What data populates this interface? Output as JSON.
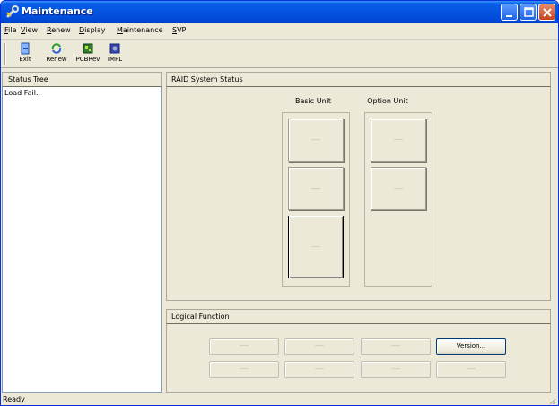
{
  "window": {
    "title": "Maintenance"
  },
  "menu": [
    {
      "label": "File",
      "hotkey": "F",
      "rest": "ile"
    },
    {
      "label": "View",
      "hotkey": "V",
      "rest": "iew"
    },
    {
      "label": "Renew",
      "hotkey": "R",
      "rest": "enew"
    },
    {
      "label": "Display",
      "hotkey": "D",
      "rest": "isplay"
    },
    {
      "label": "Maintenance",
      "hotkey": "M",
      "rest": "aintenance"
    },
    {
      "label": "SVP",
      "hotkey": "S",
      "rest": "VP"
    }
  ],
  "toolbar": {
    "exit": "Exit",
    "renew": "Renew",
    "pcbrev": "PCBRev",
    "impl": "IMPL"
  },
  "status_tree": {
    "header": "Status Tree",
    "message": "Load Fail.."
  },
  "raid": {
    "header": "RAID System Status",
    "basic_unit_label": "Basic Unit",
    "option_unit_label": "Option Unit",
    "slot_placeholder": "----"
  },
  "logical": {
    "header": "Logical Function",
    "placeholder": "----",
    "version_label": "Version..."
  },
  "statusbar": {
    "text": "Ready"
  },
  "colors": {
    "titlebar": "#0553e0",
    "face": "#ece9d8",
    "close": "#c4431f"
  }
}
